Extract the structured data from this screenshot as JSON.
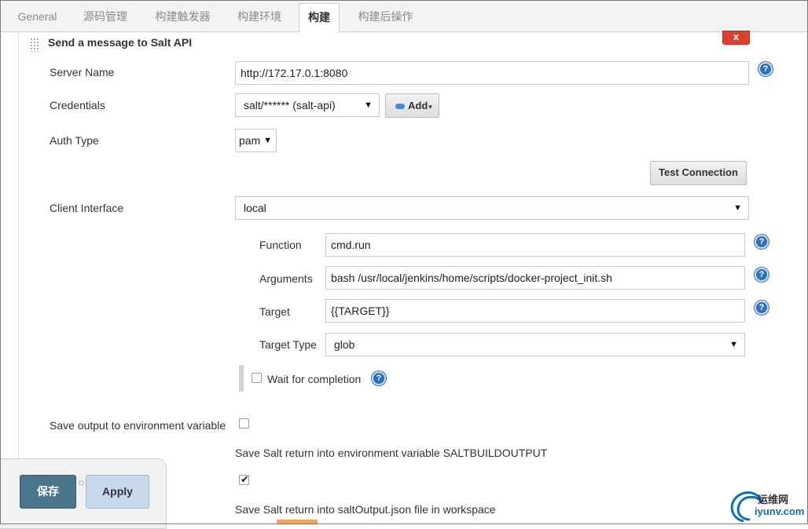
{
  "tabs": [
    {
      "label": "General"
    },
    {
      "label": "源码管理"
    },
    {
      "label": "构建触发器"
    },
    {
      "label": "构建环境"
    },
    {
      "label": "构建"
    },
    {
      "label": "构建后操作"
    }
  ],
  "active_tab": "构建",
  "section": {
    "title": "Send a message to Salt API",
    "delete_label": "x"
  },
  "form": {
    "server_name": {
      "label": "Server Name",
      "value": "http://172.17.0.1:8080"
    },
    "credentials": {
      "label": "Credentials",
      "value": "salt/****** (salt-api)",
      "add_label": "Add"
    },
    "auth_type": {
      "label": "Auth Type",
      "value": "pam"
    },
    "test_connection_label": "Test Connection",
    "client_interface": {
      "label": "Client Interface",
      "value": "local"
    },
    "function": {
      "label": "Function",
      "value": "cmd.run"
    },
    "arguments": {
      "label": "Arguments",
      "value": "bash /usr/local/jenkins/home/scripts/docker-project_init.sh"
    },
    "target": {
      "label": "Target",
      "value": "{{TARGET}}"
    },
    "target_type": {
      "label": "Target Type",
      "value": "glob"
    },
    "wait_for_completion": {
      "label": "Wait for completion",
      "checked": false
    },
    "save_output_env": {
      "label": "Save output to environment variable",
      "checked": false
    },
    "save_output_env_desc": "Save Salt return into environment variable SALTBUILDOUTPUT",
    "save_output_file": {
      "checked": true
    },
    "save_output_file_desc": "Save Salt return into saltOutput.json file in workspace"
  },
  "footer": {
    "save_label": "保存",
    "apply_label": "Apply",
    "partial_text": "o"
  },
  "help_glyph": "?",
  "watermark": {
    "line1": "运维网",
    "line2": "iyunv.com"
  },
  "colors": {
    "save_button": "#4b758b",
    "apply_button": "#c7d9ea",
    "delete_button": "#d9412e",
    "help_icon": "#2f70b8"
  }
}
